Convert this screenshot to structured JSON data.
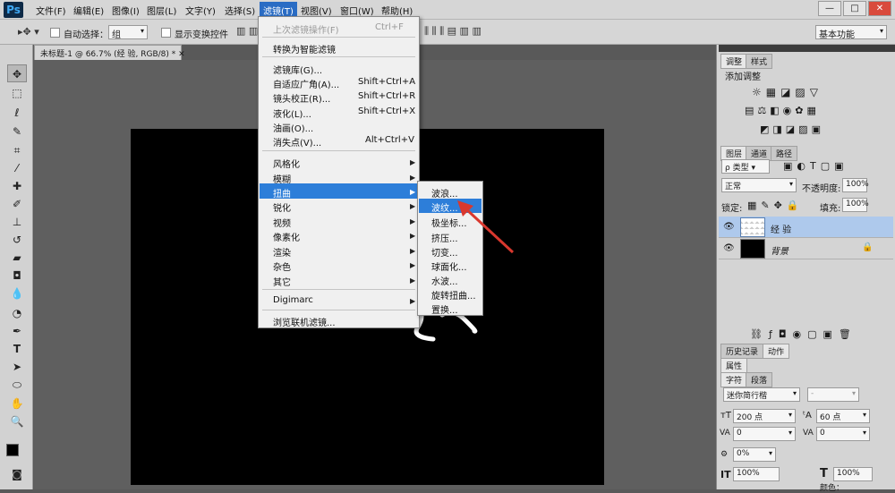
{
  "app": {
    "logo": "Ps"
  },
  "menubar": {
    "items": [
      "文件(F)",
      "编辑(E)",
      "图像(I)",
      "图层(L)",
      "文字(Y)",
      "选择(S)",
      "滤镜(T)",
      "视图(V)",
      "窗口(W)",
      "帮助(H)"
    ],
    "window_buttons": [
      "—",
      "□",
      "✕"
    ]
  },
  "options": {
    "auto_select": "自动选择：",
    "auto_select_value": "组",
    "show_transform": "显示变换控件",
    "workspace": "基本功能"
  },
  "document": {
    "tab_title": "未标题-1 @ 66.7% (经 验, RGB/8) *"
  },
  "filter_menu": {
    "items": [
      {
        "label": "上次滤镜操作(F)",
        "shortcut": "Ctrl+F",
        "disabled": true
      },
      {
        "label": "转换为智能滤镜"
      },
      {
        "label": "滤镜库(G)..."
      },
      {
        "label": "自适应广角(A)...",
        "shortcut": "Shift+Ctrl+A"
      },
      {
        "label": "镜头校正(R)...",
        "shortcut": "Shift+Ctrl+R"
      },
      {
        "label": "液化(L)...",
        "shortcut": "Shift+Ctrl+X"
      },
      {
        "label": "油画(O)..."
      },
      {
        "label": "消失点(V)...",
        "shortcut": "Alt+Ctrl+V"
      },
      {
        "label": "风格化",
        "submenu": true
      },
      {
        "label": "模糊",
        "submenu": true
      },
      {
        "label": "扭曲",
        "submenu": true,
        "highlighted": true
      },
      {
        "label": "锐化",
        "submenu": true
      },
      {
        "label": "视频",
        "submenu": true
      },
      {
        "label": "像素化",
        "submenu": true
      },
      {
        "label": "渲染",
        "submenu": true
      },
      {
        "label": "杂色",
        "submenu": true
      },
      {
        "label": "其它",
        "submenu": true
      },
      {
        "label": "Digimarc",
        "submenu": true
      },
      {
        "label": "浏览联机滤镜..."
      }
    ]
  },
  "distort_submenu": {
    "items": [
      "波浪...",
      "波纹...",
      "极坐标...",
      "挤压...",
      "切变...",
      "球面化...",
      "水波...",
      "旋转扭曲...",
      "置换..."
    ],
    "highlighted": "波纹..."
  },
  "adjust_panel": {
    "tabs": [
      "调整",
      "样式"
    ],
    "title": "添加调整"
  },
  "layers_panel": {
    "tabs": [
      "图层",
      "通道",
      "路径"
    ],
    "filter_kind": "ρ 类型",
    "blend_mode": "正常",
    "opacity_label": "不透明度:",
    "opacity": "100%",
    "lock_label": "锁定:",
    "fill_label": "填充:",
    "fill": "100%",
    "layers": [
      {
        "name": "经 验",
        "type": "text"
      },
      {
        "name": "背景",
        "locked": true
      }
    ]
  },
  "history_panel": {
    "tabs": [
      "历史记录",
      "动作"
    ]
  },
  "properties_panel": {
    "title": "属性"
  },
  "character_panel": {
    "tabs": [
      "字符",
      "段落"
    ],
    "font": "迷你简行楷",
    "style": "-",
    "size": "200 点",
    "leading": "60 点",
    "kerning": "0",
    "tracking": "0",
    "scale_pct": "0%",
    "vertical_scale": "100%",
    "horizontal_scale": "100%",
    "color_label": "颜色："
  },
  "colors": {
    "accent": "#2d7ed9",
    "canvas": "#000000",
    "menu_bg": "#f0f0f0",
    "annotation_arrow": "#d9382e"
  }
}
